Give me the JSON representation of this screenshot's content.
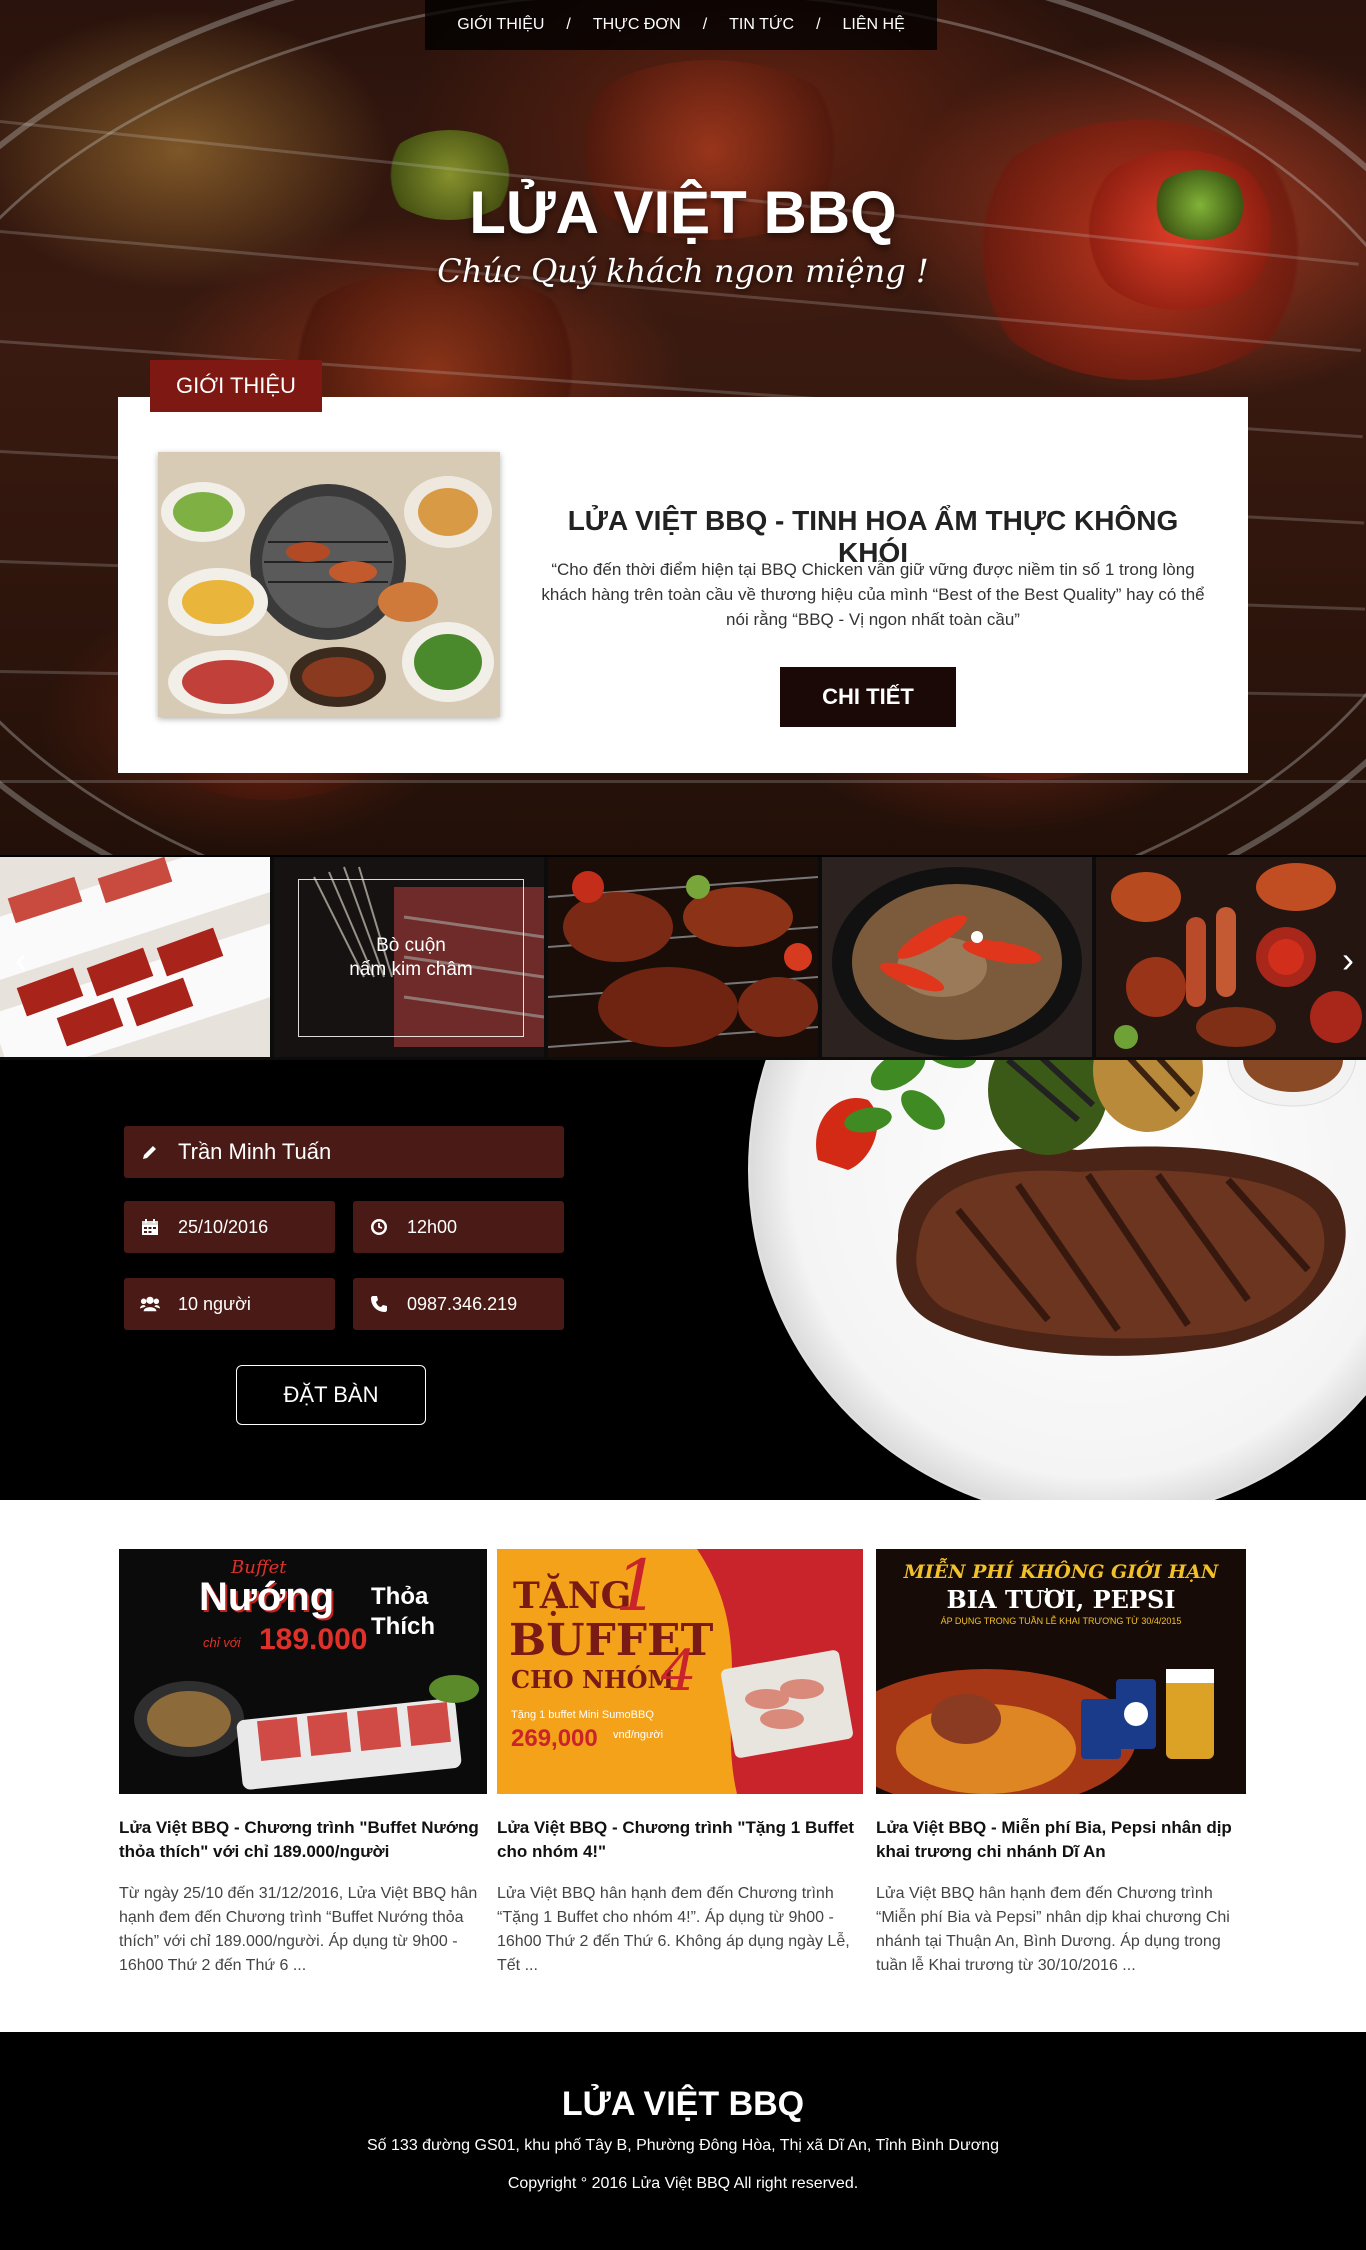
{
  "nav": {
    "items": [
      "GIỚI THIỆU",
      "THỰC ĐƠN",
      "TIN TỨC",
      "LIÊN HỆ"
    ],
    "separator": "/"
  },
  "hero": {
    "title": "LỬA VIỆT BBQ",
    "tagline": "Chúc Quý khách ngon miệng !"
  },
  "intro": {
    "tab_label": "GIỚI THIỆU",
    "headline": "LỬA VIỆT BBQ - TINH HOA ẨM THỰC KHÔNG KHÓI",
    "text": "“Cho đến thời điểm hiện tại BBQ Chicken vẫn giữ vững được niềm tin số 1 trong lòng khách hàng trên toàn cầu về thương hiệu của mình “Best of the Best Quality” hay có thể nói rằng “BBQ - Vị ngon nhất toàn cầu”",
    "button_label": "CHI TIẾT"
  },
  "gallery": {
    "caption": "Bò cuộn\nnấm kim châm",
    "prev_icon": "chevron-left-icon",
    "next_icon": "chevron-right-icon"
  },
  "booking": {
    "name": "Trần Minh Tuấn",
    "date": "25/10/2016",
    "time": "12h00",
    "guests": "10 người",
    "phone": "0987.346.219",
    "button_label": "ĐẶT BÀN",
    "field_color": "#4a1a16"
  },
  "news": [
    {
      "title": "Lửa Việt BBQ - Chương trình \"Buffet Nướng thỏa thích\" với chỉ 189.000/người",
      "text": "Từ ngày 25/10 đến 31/12/2016, Lửa Việt BBQ hân hạnh đem đến Chương trình “Buffet Nướng thỏa thích” với chỉ 189.000/người. Áp dụng từ 9h00 - 16h00 Thứ 2 đến Thứ 6 ...",
      "poster": {
        "line1": "Buffet",
        "line2": "Nướng",
        "line3": "Thỏa",
        "line4": "Thích",
        "price_prefix": "chỉ với",
        "price": "189.000"
      }
    },
    {
      "title": "Lửa Việt BBQ - Chương trình \"Tặng 1 Buffet cho nhóm 4!\"",
      "text": "Lửa Việt BBQ hân hạnh đem đến Chương trình “Tặng 1 Buffet cho nhóm 4!”. Áp dụng từ 9h00 - 16h00 Thứ 2 đến Thứ 6. Không áp dụng ngày Lễ, Tết ...",
      "poster": {
        "line1": "TẶNG",
        "line2": "BUFFET",
        "line3": "CHO NHÓM",
        "num1": "1",
        "num2": "4",
        "small": "Tặng 1 buffet Mini SumoBBQ",
        "price": "269,000",
        "unit": "vnđ/người"
      }
    },
    {
      "title": "Lửa Việt BBQ - Miễn phí Bia, Pepsi nhân dịp khai trương chi nhánh Dĩ An",
      "text": "Lửa Việt BBQ hân hạnh đem đến Chương trình “Miễn phí Bia và Pepsi” nhân dịp khai chương Chi nhánh tại Thuận An, Bình Dương. Áp dụng trong tuần lễ Khai trương từ 30/10/2016 ...",
      "poster": {
        "line1": "MIỄN PHÍ KHÔNG GIỚI HẠN",
        "line2": "BIA TƯƠI, PEPSI",
        "line3": "ÁP DỤNG TRONG TUẦN LỄ KHAI TRƯƠNG TỪ 30/4/2015"
      }
    }
  ],
  "footer": {
    "brand": "LỬA VIỆT BBQ",
    "address": "Số 133 đường GS01, khu phố Tây B, Phường Đông Hòa, Thị xã Dĩ An, Tỉnh Bình Dương",
    "copyright": "Copyright ° 2016 Lửa Việt BBQ All right reserved."
  },
  "colors": {
    "accent": "#7d1812",
    "dark_button": "#1a0907",
    "footer_bg": "#000000"
  }
}
